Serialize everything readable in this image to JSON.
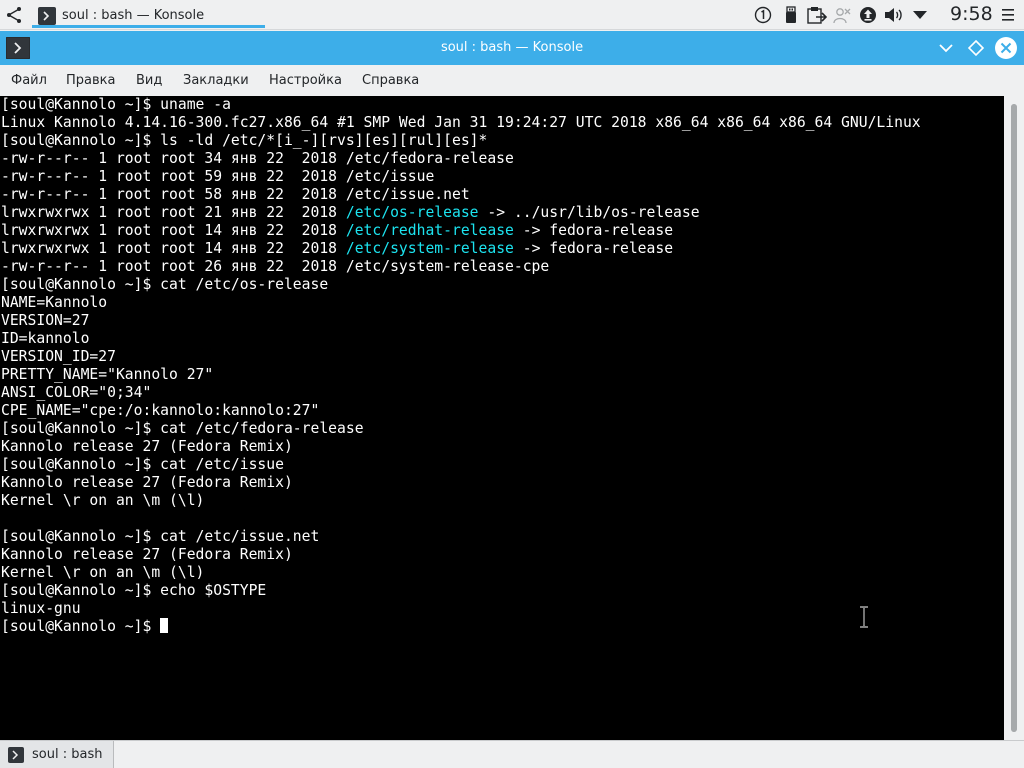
{
  "taskbar": {
    "task_title": "soul : bash — Konsole",
    "clock": "9:58"
  },
  "window": {
    "title": "soul : bash — Konsole"
  },
  "menu": {
    "items": [
      "Файл",
      "Правка",
      "Вид",
      "Закладки",
      "Настройка",
      "Справка"
    ]
  },
  "terminal": {
    "lines": [
      [
        {
          "t": "[soul@Kannolo ~]$ uname -a"
        }
      ],
      [
        {
          "t": "Linux Kannolo 4.14.16-300.fc27.x86_64 #1 SMP Wed Jan 31 19:24:27 UTC 2018 x86_64 x86_64 x86_64 GNU/Linux"
        }
      ],
      [
        {
          "t": "[soul@Kannolo ~]$ ls -ld /etc/*[i_-][rvs][es][rul][es]*"
        }
      ],
      [
        {
          "t": "-rw-r--r-- 1 root root 34 янв 22  2018 /etc/fedora-release"
        }
      ],
      [
        {
          "t": "-rw-r--r-- 1 root root 59 янв 22  2018 /etc/issue"
        }
      ],
      [
        {
          "t": "-rw-r--r-- 1 root root 58 янв 22  2018 /etc/issue.net"
        }
      ],
      [
        {
          "t": "lrwxrwxrwx 1 root root 21 янв 22  2018 "
        },
        {
          "t": "/etc/os-release",
          "c": "hl"
        },
        {
          "t": " -> ../usr/lib/os-release"
        }
      ],
      [
        {
          "t": "lrwxrwxrwx 1 root root 14 янв 22  2018 "
        },
        {
          "t": "/etc/redhat-release",
          "c": "hl"
        },
        {
          "t": " -> fedora-release"
        }
      ],
      [
        {
          "t": "lrwxrwxrwx 1 root root 14 янв 22  2018 "
        },
        {
          "t": "/etc/system-release",
          "c": "hl"
        },
        {
          "t": " -> fedora-release"
        }
      ],
      [
        {
          "t": "-rw-r--r-- 1 root root 26 янв 22  2018 /etc/system-release-cpe"
        }
      ],
      [
        {
          "t": "[soul@Kannolo ~]$ cat /etc/os-release"
        }
      ],
      [
        {
          "t": "NAME=Kannolo"
        }
      ],
      [
        {
          "t": "VERSION=27"
        }
      ],
      [
        {
          "t": "ID=kannolo"
        }
      ],
      [
        {
          "t": "VERSION_ID=27"
        }
      ],
      [
        {
          "t": "PRETTY_NAME=\"Kannolo 27\""
        }
      ],
      [
        {
          "t": "ANSI_COLOR=\"0;34\""
        }
      ],
      [
        {
          "t": "CPE_NAME=\"cpe:/o:kannolo:kannolo:27\""
        }
      ],
      [
        {
          "t": "[soul@Kannolo ~]$ cat /etc/fedora-release"
        }
      ],
      [
        {
          "t": "Kannolo release 27 (Fedora Remix)"
        }
      ],
      [
        {
          "t": "[soul@Kannolo ~]$ cat /etc/issue"
        }
      ],
      [
        {
          "t": "Kannolo release 27 (Fedora Remix)"
        }
      ],
      [
        {
          "t": "Kernel \\r on an \\m (\\l)"
        }
      ],
      [
        {
          "t": ""
        }
      ],
      [
        {
          "t": "[soul@Kannolo ~]$ cat /etc/issue.net"
        }
      ],
      [
        {
          "t": "Kannolo release 27 (Fedora Remix)"
        }
      ],
      [
        {
          "t": "Kernel \\r on an \\m (\\l)"
        }
      ],
      [
        {
          "t": "[soul@Kannolo ~]$ echo $OSTYPE"
        }
      ],
      [
        {
          "t": "linux-gnu"
        }
      ],
      [
        {
          "t": "[soul@Kannolo ~]$ "
        },
        {
          "cursor": true
        }
      ]
    ],
    "highlight_color": "#1ce4f0",
    "text_color": "#ffffff",
    "background": "#000000"
  },
  "tabs": {
    "items": [
      {
        "label": "soul : bash"
      }
    ]
  },
  "colors": {
    "accent": "#3daee9"
  }
}
